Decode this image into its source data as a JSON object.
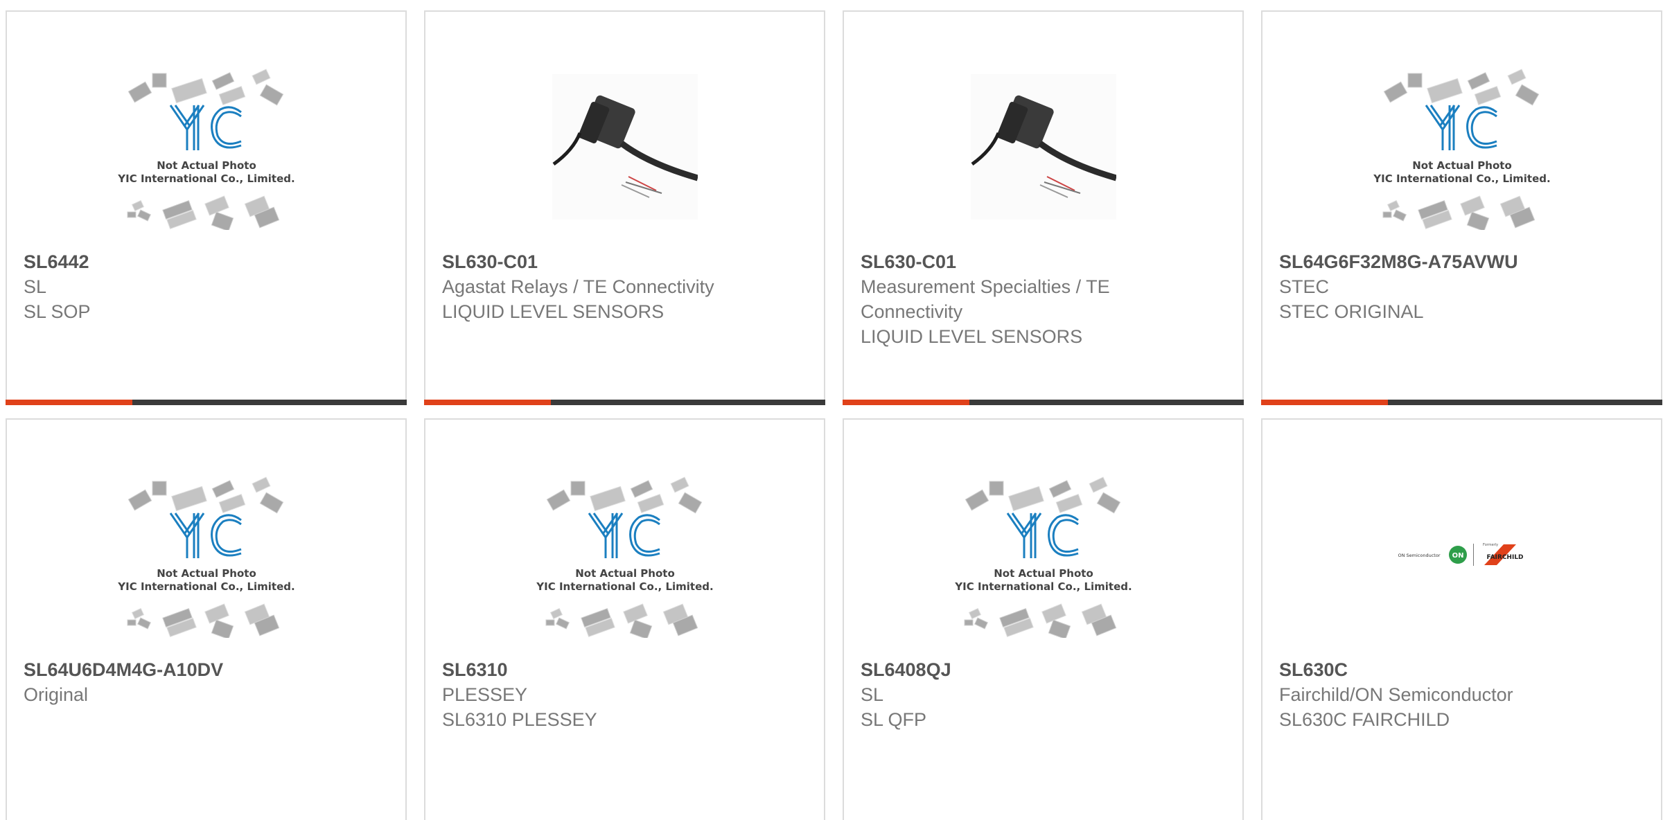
{
  "products": [
    {
      "part_number": "SL6442",
      "line1": "SL",
      "line2": "SL SOP",
      "line3": "",
      "image": "placeholder",
      "image_caption1": "Not Actual Photo",
      "image_caption2": "YIC International Co., Limited.",
      "image_logo": "YIC"
    },
    {
      "part_number": "SL630-C01",
      "line1": "Agastat Relays / TE Connectivity",
      "line2": "LIQUID LEVEL SENSORS",
      "line3": "",
      "image": "sensor-photo"
    },
    {
      "part_number": "SL630-C01",
      "line1": "Measurement Specialties / TE",
      "line2": "Connectivity",
      "line3": "LIQUID LEVEL SENSORS",
      "image": "sensor-photo"
    },
    {
      "part_number": "SL64G6F32M8G-A75AVWU",
      "line1": "STEC",
      "line2": "STEC ORIGINAL",
      "line3": "",
      "image": "placeholder",
      "image_caption1": "Not Actual Photo",
      "image_caption2": "YIC International Co., Limited.",
      "image_logo": "YIC"
    },
    {
      "part_number": "SL64U6D4M4G-A10DV",
      "line1": "Original",
      "line2": "",
      "line3": "",
      "image": "placeholder",
      "image_caption1": "Not Actual Photo",
      "image_caption2": "YIC International Co., Limited.",
      "image_logo": "YIC"
    },
    {
      "part_number": "SL6310",
      "line1": "PLESSEY",
      "line2": "SL6310 PLESSEY",
      "line3": "",
      "image": "placeholder",
      "image_caption1": "Not Actual Photo",
      "image_caption2": "YIC International Co., Limited.",
      "image_logo": "YIC"
    },
    {
      "part_number": "SL6408QJ",
      "line1": "SL",
      "line2": "SL QFP",
      "line3": "",
      "image": "placeholder",
      "image_caption1": "Not Actual Photo",
      "image_caption2": "YIC International Co., Limited.",
      "image_logo": "YIC"
    },
    {
      "part_number": "SL630C",
      "line1": "Fairchild/ON Semiconductor",
      "line2": "SL630C FAIRCHILD",
      "line3": "",
      "image": "brand-logo",
      "logo_left_text": "ON Semiconductor",
      "logo_mark": "ON",
      "logo_formerly": "Formerly",
      "logo_right_text": "FAIRCHILD"
    }
  ],
  "colors": {
    "accent": "#e0411a",
    "bar": "#3a3a3a",
    "yic_blue": "#1b7fc0",
    "on_green": "#2e9e4a",
    "fairchild_red": "#e0411a"
  }
}
